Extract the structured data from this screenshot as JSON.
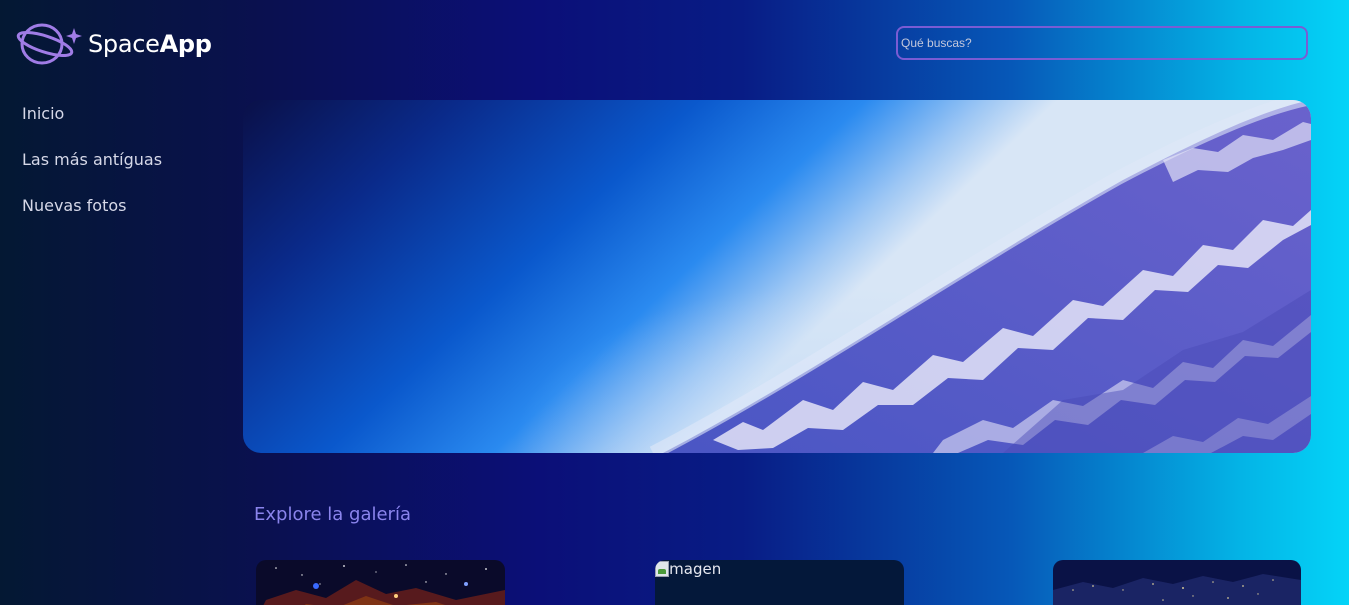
{
  "header": {
    "logo": {
      "text_light": "Space",
      "text_bold": "App"
    },
    "search": {
      "placeholder": "Qué buscas?",
      "value": ""
    }
  },
  "sidebar": {
    "items": [
      {
        "label": "Inicio"
      },
      {
        "label": "Las más antíguas"
      },
      {
        "label": "Nuevas fotos"
      }
    ]
  },
  "banner": {
    "icon": "earth-from-space-image"
  },
  "gallery": {
    "title": "Explore la galería",
    "cards": [
      {
        "icon": "nebula-image"
      },
      {
        "alt": "imagen"
      },
      {
        "icon": "earth-night-map-image"
      }
    ]
  },
  "colors": {
    "accent": "#7a5cd4",
    "gallery_title": "#8a84ec"
  }
}
